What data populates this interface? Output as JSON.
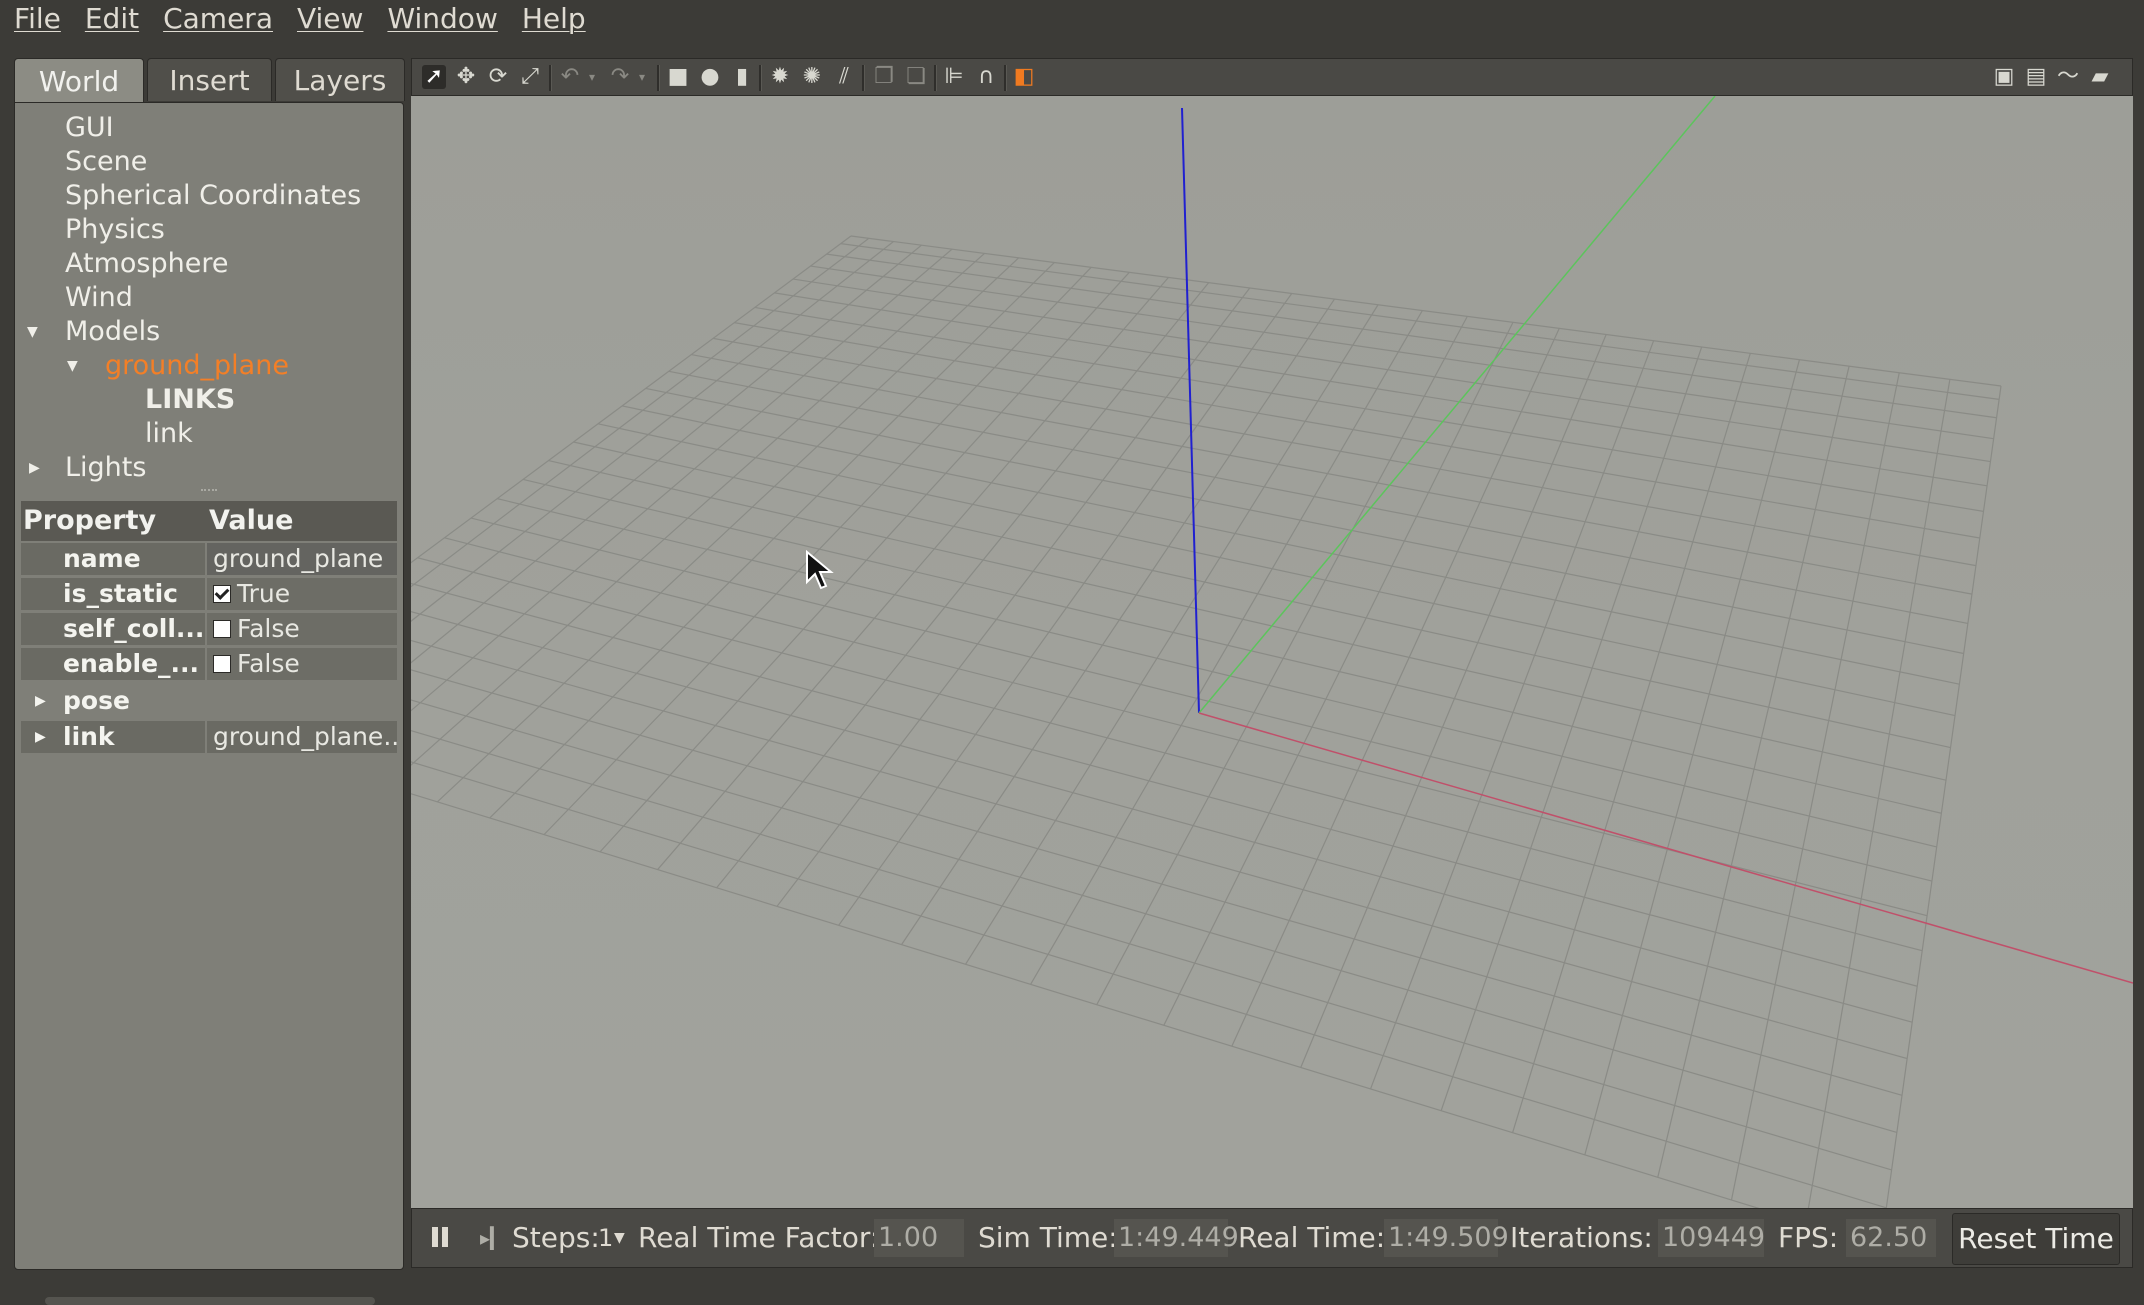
{
  "menu": [
    "File",
    "Edit",
    "Camera",
    "View",
    "Window",
    "Help"
  ],
  "tabs": [
    "World",
    "Insert",
    "Layers"
  ],
  "tree": {
    "gui": "GUI",
    "scene": "Scene",
    "spherical": "Spherical Coordinates",
    "physics": "Physics",
    "atmosphere": "Atmosphere",
    "wind": "Wind",
    "models": "Models",
    "ground_plane": "ground_plane",
    "links_header": "LINKS",
    "link": "link",
    "lights": "Lights"
  },
  "properties": {
    "header_property": "Property",
    "header_value": "Value",
    "rows": [
      {
        "name": "name",
        "value": "ground_plane"
      },
      {
        "name": "is_static",
        "value": "True",
        "checked": true
      },
      {
        "name": "self_coll...",
        "value": "False",
        "checked": false
      },
      {
        "name": "enable_...",
        "value": "False",
        "checked": false
      }
    ],
    "pose": "pose",
    "link_name": "link",
    "link_value": "ground_plane.."
  },
  "bottom": {
    "steps_label": "Steps:",
    "steps_value": "1",
    "rtf_label": "Real Time Factor:",
    "rtf_value": "1.00",
    "sim_time_label": "Sim Time:",
    "sim_time_value": "1:49.449",
    "real_time_label": "Real Time:",
    "real_time_value": "1:49.509",
    "iterations_label": "Iterations:",
    "iterations_value": "109449",
    "fps_label": "FPS:",
    "fps_value": "62.50",
    "reset_label": "Reset Time"
  },
  "colors": {
    "selected_model": "#f37f27",
    "axis_x": "#c0506a",
    "axis_y": "#5cc45c",
    "axis_z": "#2020d0",
    "viewport_bg": "#9fa09a"
  }
}
